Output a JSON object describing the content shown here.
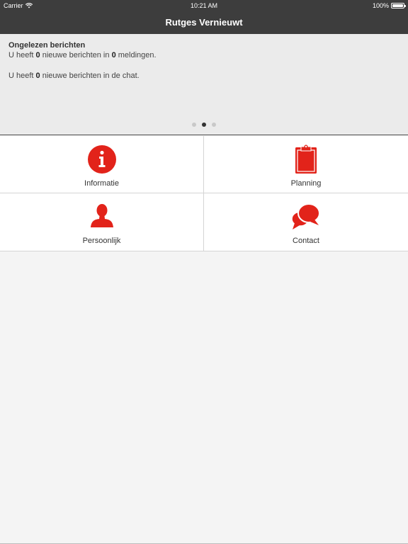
{
  "status_bar": {
    "carrier": "Carrier",
    "time": "10:21 AM",
    "battery": "100%"
  },
  "nav": {
    "title": "Rutges Vernieuwt"
  },
  "banner": {
    "title": "Ongelezen berichten",
    "line1_prefix": "U heeft ",
    "line1_count": "0",
    "line1_middle": " nieuwe berichten in ",
    "line1_count2": "0",
    "line1_suffix": " meldingen.",
    "line2_prefix": "U heeft ",
    "line2_count": "0",
    "line2_suffix": " nieuwe berichten in de chat.",
    "page_count": 3,
    "active_page": 2
  },
  "menu": {
    "informatie": {
      "label": "Informatie",
      "icon": "info-icon"
    },
    "planning": {
      "label": "Planning",
      "icon": "clipboard-icon"
    },
    "persoonlijk": {
      "label": "Persoonlijk",
      "icon": "person-icon"
    },
    "contact": {
      "label": "Contact",
      "icon": "chat-bubbles-icon"
    }
  },
  "colors": {
    "accent": "#e2231a",
    "nav_bg": "#3d3d3d"
  }
}
